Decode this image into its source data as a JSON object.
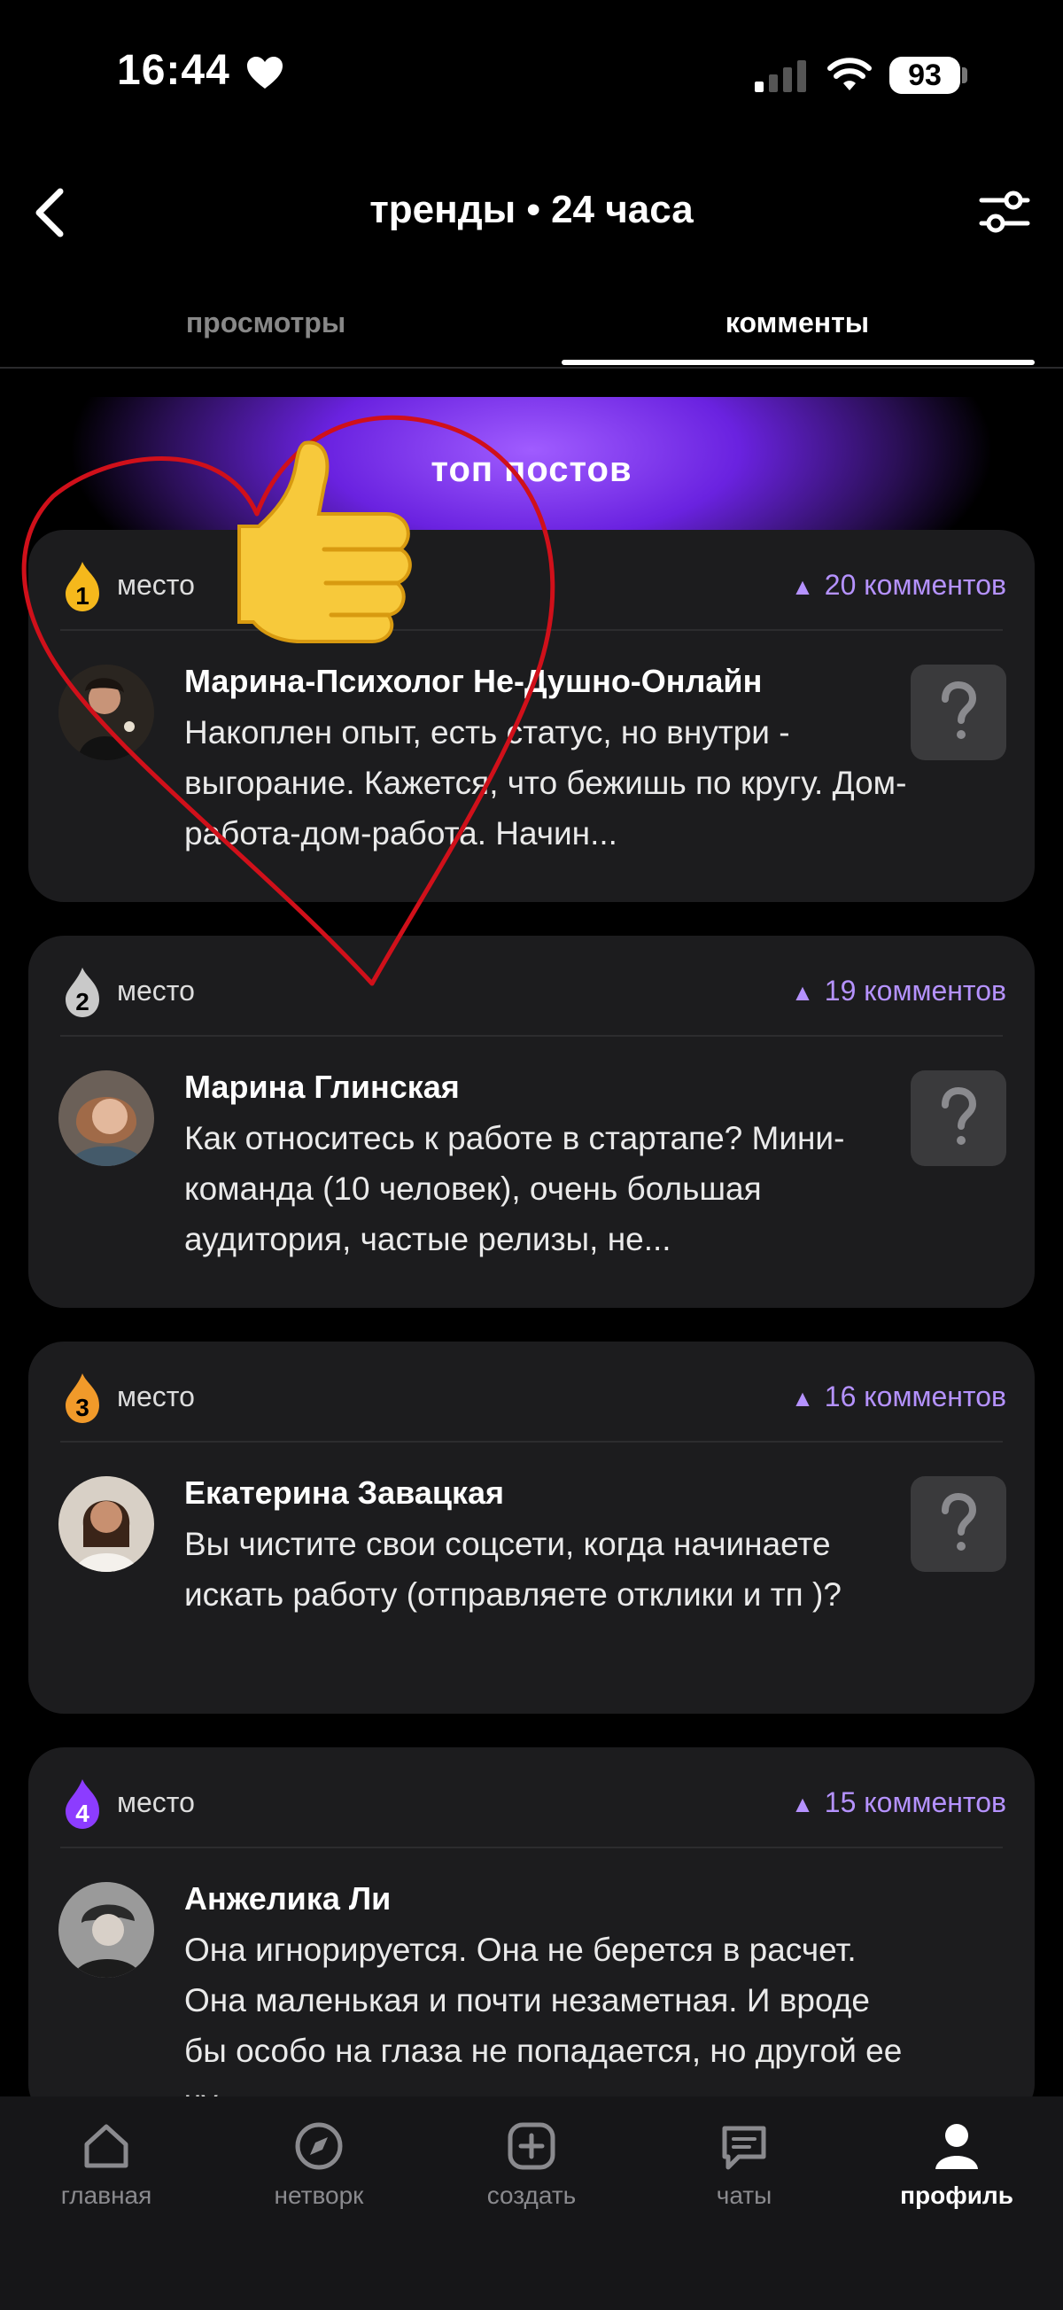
{
  "status_bar": {
    "time": "16:44",
    "battery": "93"
  },
  "header": {
    "title": "тренды • 24 часа"
  },
  "tabs": [
    {
      "label": "просмотры"
    },
    {
      "label": "комменты"
    }
  ],
  "banner": {
    "title": "топ постов"
  },
  "posts": [
    {
      "rank": "1",
      "place_label": "место",
      "comments": "20 комментов",
      "author": "Марина-Психолог Не-Душно-Онлайн",
      "text": "Накоплен опыт, есть статус, но внутри - выгорание. Кажется, что бежишь по кругу. Дом-работа-дом-работа. Начин...",
      "rank_color": "#f5b81c"
    },
    {
      "rank": "2",
      "place_label": "место",
      "comments": "19 комментов",
      "author": "Марина Глинская",
      "text": "Как относитесь к работе в стартапе? Мини-команда (10 человек), очень большая аудитория, частые релизы, не...",
      "rank_color": "#c9c9c9"
    },
    {
      "rank": "3",
      "place_label": "место",
      "comments": "16 комментов",
      "author": "Екатерина Завацкая",
      "text": "Вы чистите свои соцсети, когда начинаете искать работу (отправляете отклики и тп )?",
      "rank_color": "#f19a2a"
    },
    {
      "rank": "4",
      "place_label": "место",
      "comments": "15 комментов",
      "author": "Анжелика Ли",
      "text": "Она игнорируется. Она не берется в расчет. Она маленькая и почти незаметная. И вроде бы особо на глаза не попадается, но другой ее чу...",
      "rank_color": "#8c3cff"
    }
  ],
  "bottom_nav": [
    {
      "label": "главная",
      "icon": "home-icon"
    },
    {
      "label": "нетворк",
      "icon": "compass-icon"
    },
    {
      "label": "создать",
      "icon": "plus-square-icon"
    },
    {
      "label": "чаты",
      "icon": "chat-icon"
    },
    {
      "label": "профиль",
      "icon": "profile-icon"
    }
  ],
  "colors": {
    "accent": "#b592ff",
    "card_bg": "#1c1c1e",
    "background": "#000000",
    "scribble": "#d0101a"
  }
}
